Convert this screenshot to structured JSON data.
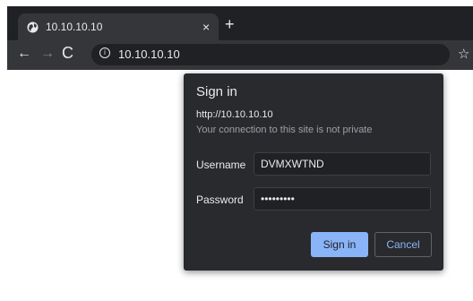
{
  "tab": {
    "title": "10.10.10.10",
    "close": "×",
    "new_tab": "+"
  },
  "toolbar": {
    "back": "←",
    "forward": "→",
    "reload": "C",
    "info": "i",
    "url": "10.10.10.10",
    "star": "☆"
  },
  "dialog": {
    "title": "Sign in",
    "origin": "http://10.10.10.10",
    "warning": "Your connection to this site is not private",
    "username_label": "Username",
    "username_value": "DVMXWTND",
    "password_label": "Password",
    "password_value": "•••••••••",
    "signin_label": "Sign in",
    "cancel_label": "Cancel"
  },
  "colors": {
    "frame": "#202124",
    "toolbar": "#35363a",
    "dialog": "#292a2d",
    "accent": "#8ab4f8"
  }
}
